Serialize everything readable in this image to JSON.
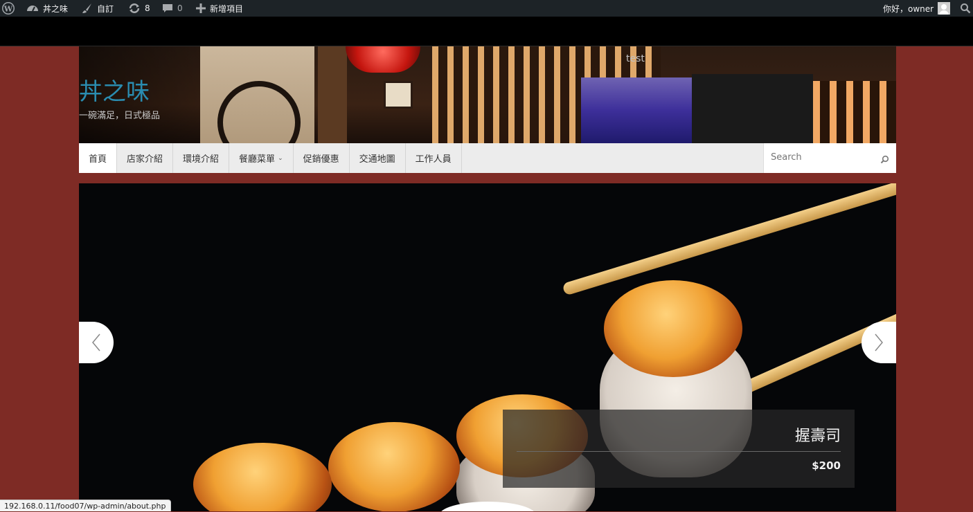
{
  "admin_bar": {
    "site_name": "丼之味",
    "customize": "自訂",
    "updates_count": "8",
    "comments_count": "0",
    "new_item": "新增項目",
    "greeting": "你好，owner"
  },
  "header": {
    "site_title": "丼之味",
    "tagline": "一碗滿足，日式極品",
    "test_label": "test"
  },
  "nav": {
    "items": [
      {
        "label": "首頁"
      },
      {
        "label": "店家介紹"
      },
      {
        "label": "環境介紹"
      },
      {
        "label": "餐廳菜單"
      },
      {
        "label": "促銷優惠"
      },
      {
        "label": "交通地圖"
      },
      {
        "label": "工作人員"
      }
    ],
    "search_placeholder": "Search"
  },
  "slider": {
    "caption_title": "握壽司",
    "caption_price": "$200"
  },
  "status_url": "192.168.0.11/food07/wp-admin/about.php",
  "colors": {
    "admin_bar_bg": "#1d2327",
    "page_bg": "#7e2b25",
    "site_title": "#2a8cb0",
    "nav_bg": "#ececec"
  }
}
